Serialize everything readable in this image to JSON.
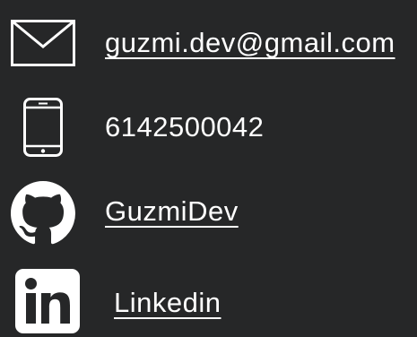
{
  "theme": {
    "background": "#262728",
    "foreground": "#ffffff"
  },
  "contacts": [
    {
      "id": "email",
      "icon": "envelope-icon",
      "text": "guzmi.dev@gmail.com",
      "is_link": true
    },
    {
      "id": "phone",
      "icon": "smartphone-icon",
      "text": "6142500042",
      "is_link": false
    },
    {
      "id": "github",
      "icon": "github-icon",
      "text": "GuzmiDev",
      "is_link": true
    },
    {
      "id": "linkedin",
      "icon": "linkedin-icon",
      "text": "Linkedin",
      "is_link": true
    }
  ]
}
